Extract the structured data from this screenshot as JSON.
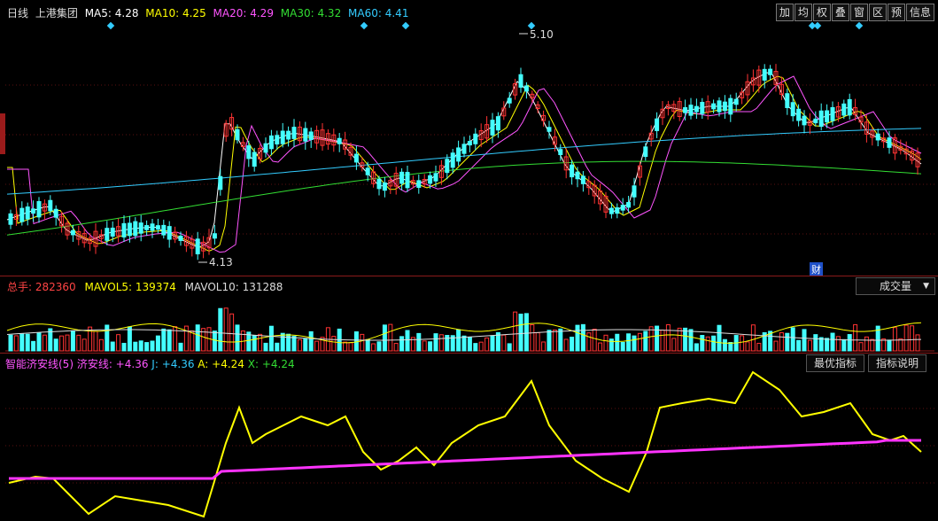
{
  "main_panel": {
    "period": "日线",
    "stock_name": "上港集团",
    "ma5": "MA5: 4.28",
    "ma10": "MA10: 4.25",
    "ma20": "MA20: 4.29",
    "ma30": "MA30: 4.32",
    "ma60": "MA60: 4.41",
    "high_label": "5.10",
    "low_label": "4.13",
    "finance_marker": "财",
    "toolbar": [
      "加",
      "均",
      "权",
      "叠",
      "窗",
      "区",
      "预",
      "信息"
    ],
    "colors": {
      "ma5": "#ffffff",
      "ma10": "#ffff00",
      "ma20": "#ff55ff",
      "ma30": "#33dd33",
      "ma60": "#33ccff",
      "up": "#ff3333",
      "down": "#44ffff"
    }
  },
  "volume_panel": {
    "total_label": "总手: ",
    "total_value": "282360",
    "mavol5": "MAVOL5: 139374",
    "mavol10": "MAVOL10: 131288",
    "selector": "成交量"
  },
  "indicator_panel": {
    "title": "智能济安线(5)",
    "jax": "济安线: +4.36",
    "j": "J: +4.36",
    "a": "A: +4.24",
    "x": "X: +4.24",
    "best_button": "最优指标",
    "help_button": "指标说明"
  }
}
